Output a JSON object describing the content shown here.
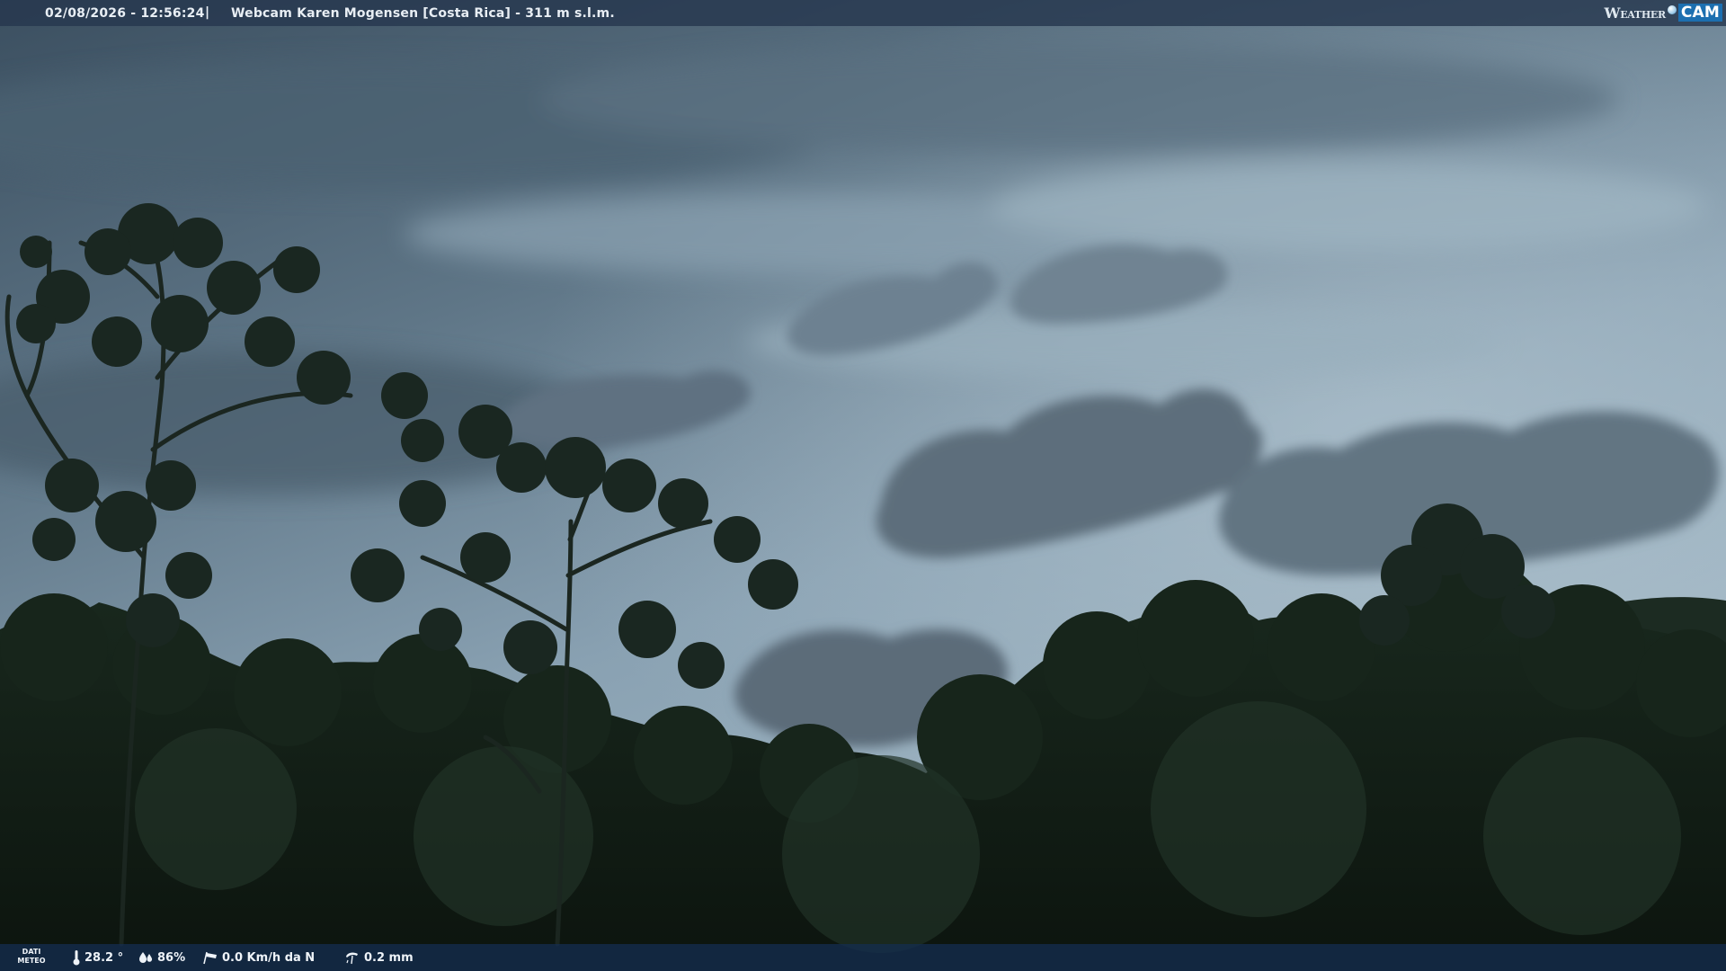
{
  "overlay": {
    "datetime": "02/08/2026 - 12:56:24",
    "separator": "|",
    "location": "Webcam Karen Mogensen [Costa Rica]  - 311 m s.l.m."
  },
  "logo": {
    "weather": "Weather",
    "cam": "CAM"
  },
  "weather_data": {
    "label_line1": "DATI",
    "label_line2": "METEO",
    "temperature": "28.2 °",
    "humidity": "86%",
    "wind": "0.0 Km/h da N",
    "rain": "0.2 mm"
  },
  "colors": {
    "sky_top": "#3f5566",
    "sky_mid": "#7f97a8",
    "sky_light": "#a9bfcc",
    "forest_dark": "#111a14",
    "overlay_bar": "#26374e"
  },
  "icons": {
    "temperature": "thermometer-icon",
    "humidity": "drops-icon",
    "wind": "windsock-icon",
    "rain": "rain-gauge-icon"
  }
}
